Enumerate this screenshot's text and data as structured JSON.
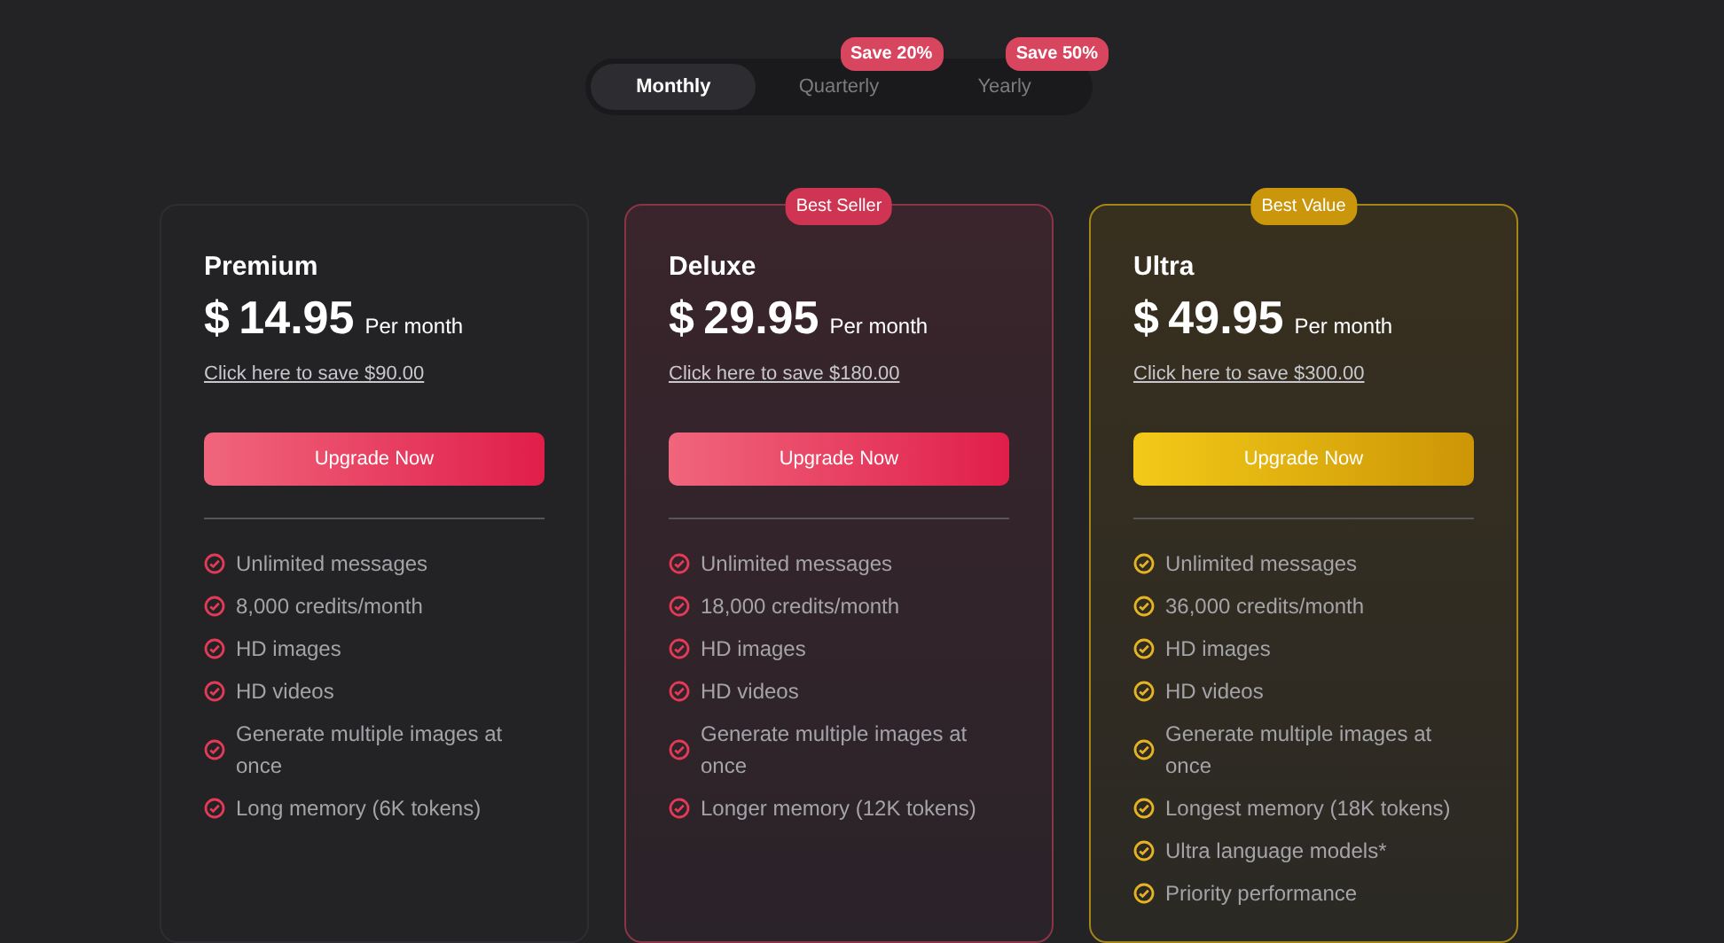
{
  "billing_tabs": [
    {
      "label": "Monthly",
      "selected": true
    },
    {
      "label": "Quarterly",
      "selected": false,
      "badge": "Save 20%"
    },
    {
      "label": "Yearly",
      "selected": false,
      "badge": "Save 50%"
    }
  ],
  "plans": [
    {
      "kind": "plain",
      "name": "Premium",
      "currency": "$",
      "price": "14.95",
      "period": "Per month",
      "save_link": "Click here to save $90.00",
      "button": "Upgrade Now",
      "features": [
        "Unlimited messages",
        "8,000 credits/month",
        "HD images",
        "HD videos",
        "Generate multiple images at once",
        "Long memory (6K tokens)"
      ]
    },
    {
      "kind": "rose",
      "badge": "Best Seller",
      "name": "Deluxe",
      "currency": "$",
      "price": "29.95",
      "period": "Per month",
      "save_link": "Click here to save $180.00",
      "button": "Upgrade Now",
      "features": [
        "Unlimited messages",
        "18,000 credits/month",
        "HD images",
        "HD videos",
        "Generate multiple images at once",
        "Longer memory (12K tokens)"
      ]
    },
    {
      "kind": "gold",
      "badge": "Best Value",
      "name": "Ultra",
      "currency": "$",
      "price": "49.95",
      "period": "Per month",
      "save_link": "Click here to save $300.00",
      "button": "Upgrade Now",
      "features": [
        "Unlimited messages",
        "36,000 credits/month",
        "HD images",
        "HD videos",
        "Generate multiple images at once",
        "Longest memory (18K tokens)",
        "Ultra language models*",
        "Priority performance"
      ]
    }
  ]
}
